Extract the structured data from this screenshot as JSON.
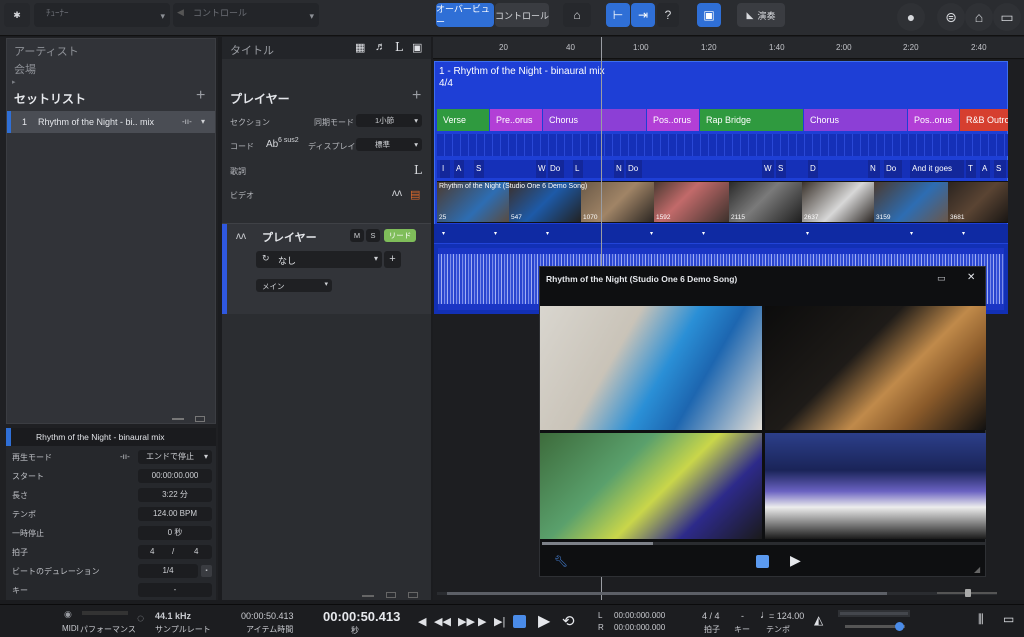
{
  "toolbar": {
    "tuner_placeholder": "ﾁｭｰﾅｰ",
    "control_placeholder": "コントロール",
    "overview_label": "オーバービュー",
    "control_label": "コントロール",
    "help_label": "?",
    "perform_label": "演奏"
  },
  "left": {
    "artist_label": "アーティスト",
    "venue_label": "会場",
    "setlist_title": "セットリスト",
    "setlist_items": [
      {
        "index": "1",
        "title": "Rhythm of the Night - bi.. mix"
      }
    ],
    "inspector": {
      "title": "Rhythm of the Night - binaural mix",
      "rows": [
        {
          "label": "再生モード",
          "value": "エンドで停止"
        },
        {
          "label": "スタート",
          "value": "00:00:00.000"
        },
        {
          "label": "長さ",
          "value": "3:22 分"
        },
        {
          "label": "テンポ",
          "value": "124.00 BPM"
        },
        {
          "label": "一時停止",
          "value": "0 秒"
        },
        {
          "label": "拍子",
          "value_a": "4",
          "value_sep": "/",
          "value_b": "4"
        },
        {
          "label": "ビートのデュレーション",
          "value": "1/4"
        },
        {
          "label": "キー",
          "value": "-"
        }
      ]
    }
  },
  "mid": {
    "title_header": "タイトル",
    "player_header": "プレイヤー",
    "section_label": "セクション",
    "sync_mode_label": "同期モード",
    "sync_mode_value": "1小節",
    "chord_label": "コード",
    "chord_symbol": "Ab",
    "chord_sup": "6 sus2",
    "display_label": "ディスプレイ",
    "display_value": "標準",
    "lyrics_label": "歌詞",
    "video_label": "ビデオ",
    "track_name": "プレイヤー",
    "mute": "M",
    "solo": "S",
    "lead": "リード",
    "preset_value": "なし",
    "output_value": "メイン"
  },
  "ruler": {
    "ticks": [
      "20",
      "40",
      "1:00",
      "1:20",
      "1:40",
      "2:00",
      "2:20",
      "2:40"
    ]
  },
  "song": {
    "title": "1 -  Rhythm of the Night - binaural mix",
    "meter": "4/4",
    "sections": [
      {
        "label": "Verse",
        "color": "#2f9a3f"
      },
      {
        "label": "Pre..orus",
        "color": "#b23fd6"
      },
      {
        "label": "Chorus",
        "color": "#8c3fd6"
      },
      {
        "label": "Pos..orus",
        "color": "#b23fd6"
      },
      {
        "label": "Rap Bridge",
        "color": "#2f9a3f"
      },
      {
        "label": "Chorus",
        "color": "#8c3fd6"
      },
      {
        "label": "Pos..orus",
        "color": "#b23fd6"
      },
      {
        "label": "R&B Outro",
        "color": "#d63f2f"
      }
    ],
    "lyrics": [
      "I",
      "A",
      "S",
      "W",
      "Do",
      "L",
      "N",
      "Do",
      "W",
      "S",
      "D",
      "N",
      "Do",
      "And it goes",
      "T",
      "A",
      "S"
    ],
    "video_title": "Rhythm of the Night (Studio One 6 Demo Song)",
    "frames": [
      "25",
      "547",
      "1070",
      "1592",
      "2115",
      "2637",
      "3159",
      "3681"
    ]
  },
  "popup": {
    "title": "Rhythm of the Night (Studio One 6 Demo Song)",
    "close": "✕"
  },
  "transport": {
    "midi": "MIDI",
    "performance": "パフォーマンス",
    "sample_rate": "44.1 kHz",
    "sample_rate_label": "サンプルレート",
    "item_time": "00:00:50.413",
    "item_time_label": "アイテム時間",
    "main_time": "00:00:50.413",
    "main_time_unit": "秒",
    "loop_l": "00:00:000.000",
    "loop_r": "00:00:000.000",
    "loop_l_label": "L",
    "loop_r_label": "R",
    "meter": "4 / 4",
    "meter_label": "拍子",
    "key": "-",
    "key_label": "キー",
    "tempo": "= 124.00",
    "tempo_label": "テンポ"
  }
}
